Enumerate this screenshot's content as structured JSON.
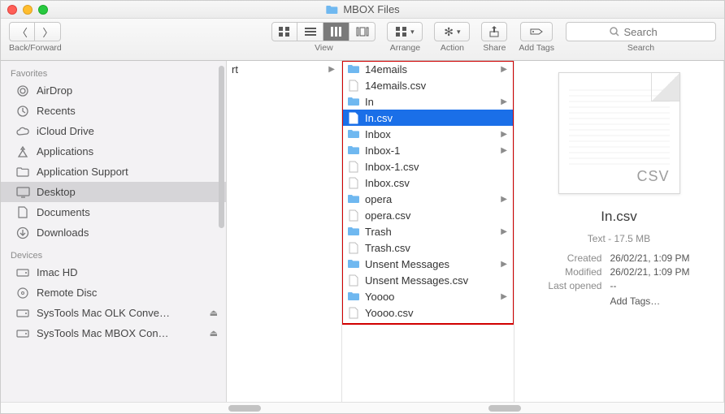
{
  "title": "MBOX Files",
  "toolbar": {
    "back_forward_label": "Back/Forward",
    "view_label": "View",
    "arrange_label": "Arrange",
    "action_label": "Action",
    "share_label": "Share",
    "add_tags_label": "Add Tags",
    "search_label": "Search",
    "search_placeholder": "Search"
  },
  "sidebar": {
    "favorites_label": "Favorites",
    "devices_label": "Devices",
    "favorites": [
      {
        "icon": "airdrop",
        "label": "AirDrop"
      },
      {
        "icon": "recents",
        "label": "Recents"
      },
      {
        "icon": "icloud",
        "label": "iCloud Drive"
      },
      {
        "icon": "apps",
        "label": "Applications"
      },
      {
        "icon": "folder",
        "label": "Application Support"
      },
      {
        "icon": "desktop",
        "label": "Desktop",
        "selected": true
      },
      {
        "icon": "documents",
        "label": "Documents"
      },
      {
        "icon": "downloads",
        "label": "Downloads"
      }
    ],
    "devices": [
      {
        "icon": "disk",
        "label": "Imac HD"
      },
      {
        "icon": "remotedisc",
        "label": "Remote Disc"
      },
      {
        "icon": "disk",
        "label": "SysTools Mac OLK Conve…",
        "eject": true
      },
      {
        "icon": "disk",
        "label": "SysTools Mac MBOX Con…",
        "eject": true
      }
    ]
  },
  "columns": {
    "col1_trunc": "rt",
    "col2": [
      {
        "type": "folder",
        "label": "14emails",
        "has_children": true
      },
      {
        "type": "file",
        "label": "14emails.csv"
      },
      {
        "type": "folder",
        "label": "In",
        "has_children": true
      },
      {
        "type": "file",
        "label": "In.csv",
        "selected": true
      },
      {
        "type": "folder",
        "label": "Inbox",
        "has_children": true
      },
      {
        "type": "folder",
        "label": "Inbox-1",
        "has_children": true
      },
      {
        "type": "file",
        "label": "Inbox-1.csv"
      },
      {
        "type": "file",
        "label": "Inbox.csv"
      },
      {
        "type": "folder",
        "label": "opera",
        "has_children": true
      },
      {
        "type": "file",
        "label": "opera.csv"
      },
      {
        "type": "folder",
        "label": "Trash",
        "has_children": true
      },
      {
        "type": "file",
        "label": "Trash.csv"
      },
      {
        "type": "folder",
        "label": "Unsent Messages",
        "has_children": true
      },
      {
        "type": "file",
        "label": "Unsent Messages.csv"
      },
      {
        "type": "folder",
        "label": "Yoooo",
        "has_children": true
      },
      {
        "type": "file",
        "label": "Yoooo.csv"
      }
    ]
  },
  "preview": {
    "doc_type": "CSV",
    "name": "In.csv",
    "kind": "Text",
    "size": "17.5 MB",
    "created_label": "Created",
    "created_value": "26/02/21, 1:09 PM",
    "modified_label": "Modified",
    "modified_value": "26/02/21, 1:09 PM",
    "last_opened_label": "Last opened",
    "last_opened_value": "--",
    "add_tags": "Add Tags…"
  }
}
